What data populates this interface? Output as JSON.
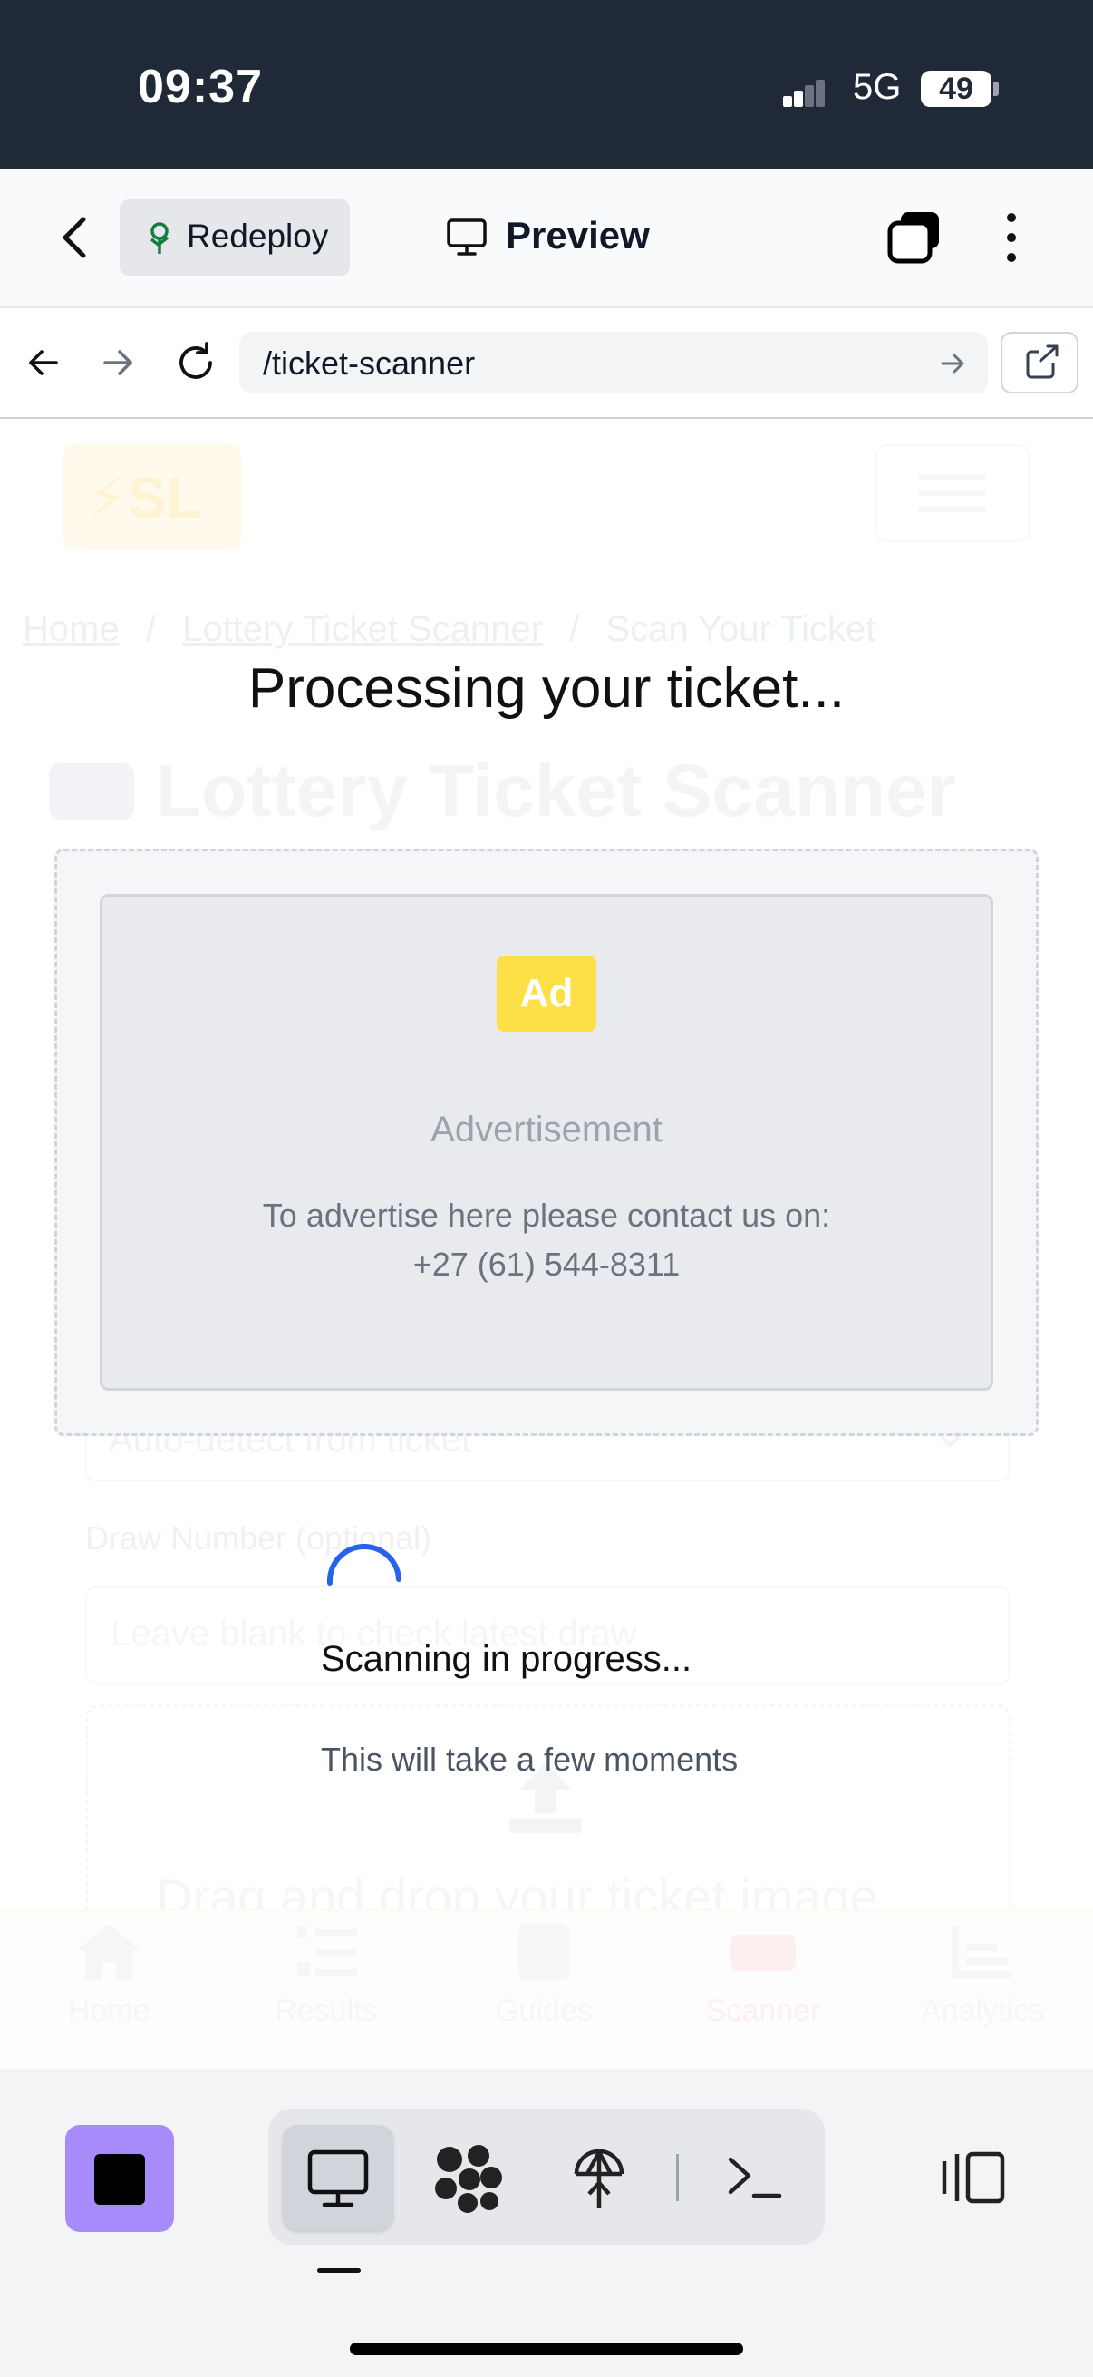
{
  "status_bar": {
    "time": "09:37",
    "network": "5G",
    "battery": "49"
  },
  "top_bar": {
    "redeploy_label": "Redeploy",
    "preview_label": "Preview"
  },
  "url_bar": {
    "url": "/ticket-scanner"
  },
  "page": {
    "logo": "⚡SL",
    "breadcrumb": {
      "home": "Home",
      "section": "Lottery Ticket Scanner",
      "current": "Scan Your Ticket",
      "separator": "/"
    },
    "title": "Lottery Ticket Scanner",
    "lottery_select": "Auto-detect from ticket",
    "draw_label": "Draw Number (optional)",
    "draw_placeholder": "Leave blank to check latest draw",
    "dropzone_text": "Drag and drop your ticket image",
    "nav": [
      {
        "label": "Home",
        "icon": "home-icon"
      },
      {
        "label": "Results",
        "icon": "list-numbered-icon"
      },
      {
        "label": "Guides",
        "icon": "book-icon"
      },
      {
        "label": "Scanner",
        "icon": "ticket-icon"
      },
      {
        "label": "Analytics",
        "icon": "chart-icon"
      }
    ]
  },
  "modal": {
    "title": "Processing your ticket...",
    "ad": {
      "badge": "Ad",
      "heading": "Advertisement",
      "contact": "To advertise here please contact us on:",
      "phone": "+27 (61) 544-8311"
    },
    "scanning_title": "Scanning in progress...",
    "scanning_subtitle": "This will take a few moments"
  },
  "colors": {
    "accent": "#2563eb",
    "stop_button": "#a78bfa",
    "ad_badge": "#fde047",
    "status_bar": "#1f2937"
  }
}
